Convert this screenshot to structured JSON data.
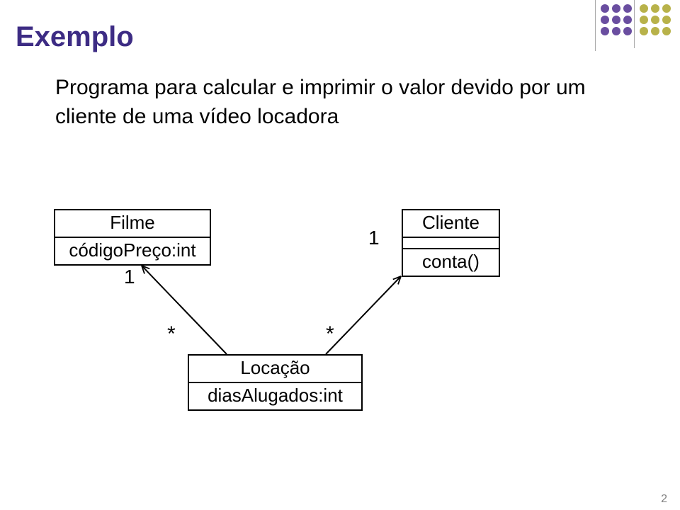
{
  "title": "Exemplo",
  "description": "Programa para calcular e imprimir o valor devido por um cliente de uma vídeo locadora",
  "classes": {
    "filme": {
      "name": "Filme",
      "attr": "códigoPreço:int"
    },
    "cliente": {
      "name": "Cliente",
      "op": "conta()"
    },
    "locacao": {
      "name": "Locação",
      "attr": "diasAlugados:int"
    }
  },
  "multiplicity": {
    "filme_side": "1",
    "cliente_side": "1",
    "locacao_left": "*",
    "locacao_right": "*"
  },
  "slide_number": "2",
  "chart_data": {
    "type": "table",
    "description": "UML class diagram with three classes and two associations",
    "classes": [
      {
        "name": "Filme",
        "attributes": [
          "códigoPreço:int"
        ],
        "operations": []
      },
      {
        "name": "Cliente",
        "attributes": [],
        "operations": [
          "conta()"
        ]
      },
      {
        "name": "Locação",
        "attributes": [
          "diasAlugados:int"
        ],
        "operations": []
      }
    ],
    "associations": [
      {
        "from": "Filme",
        "from_mult": "1",
        "to": "Locação",
        "to_mult": "*"
      },
      {
        "from": "Cliente",
        "from_mult": "1",
        "to": "Locação",
        "to_mult": "*"
      }
    ]
  }
}
